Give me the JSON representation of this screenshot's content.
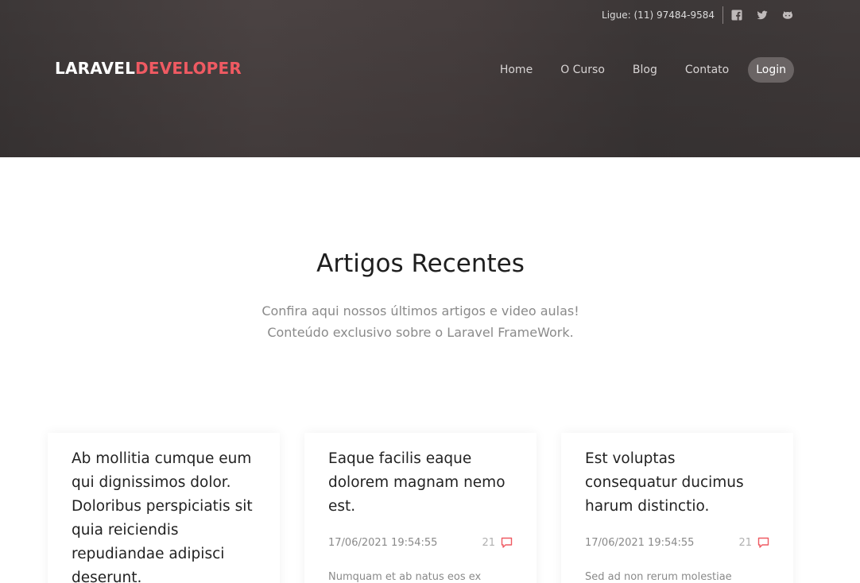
{
  "header": {
    "phone": "Ligue: (11) 97484-9584",
    "social": [
      {
        "icon": "facebook-icon"
      },
      {
        "icon": "twitter-icon"
      },
      {
        "icon": "github-icon"
      }
    ],
    "logo": {
      "part1": "LARAVEL",
      "part2": "DEVELOPER"
    },
    "nav": [
      {
        "label": "Home"
      },
      {
        "label": "O Curso"
      },
      {
        "label": "Blog"
      },
      {
        "label": "Contato"
      },
      {
        "label": "Login"
      }
    ]
  },
  "section": {
    "title": "Artigos Recentes",
    "subtitle_line1": "Confira aqui nossos últimos artigos e video aulas!",
    "subtitle_line2": "Conteúdo exclusivo sobre o Laravel FrameWork."
  },
  "cards": [
    {
      "title": "Ab mollitia cumque eum qui dignissimos dolor. Doloribus perspiciatis sit quia reiciendis repudiandae adipisci deserunt.",
      "date": "",
      "comments": "",
      "excerpt": ""
    },
    {
      "title": "Eaque facilis eaque dolorem magnam nemo est.",
      "date": "17/06/2021 19:54:55",
      "comments": "21",
      "excerpt": "Numquam et ab natus eos ex"
    },
    {
      "title": "Est voluptas consequatur ducimus harum distinctio.",
      "date": "17/06/2021 19:54:55",
      "comments": "21",
      "excerpt": "Sed ad non rerum molestiae"
    }
  ],
  "colors": {
    "brand_accent": "#ef5a62",
    "header_bg": "#453e3e",
    "active_nav_bg": "#6a6464"
  }
}
